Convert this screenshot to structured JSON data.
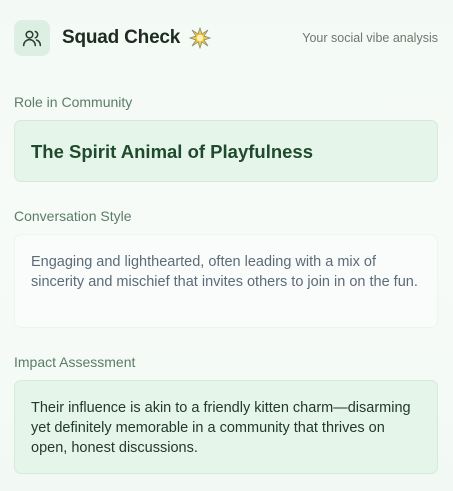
{
  "header": {
    "app_icon": "users-icon",
    "title": "Squad Check",
    "badge_icon": "sparkle-icon",
    "tagline": "Your social vibe analysis"
  },
  "sections": {
    "role": {
      "label": "Role in Community",
      "value": "The Spirit Animal of Playfulness"
    },
    "style": {
      "label": "Conversation Style",
      "value": "Engaging and lighthearted, often leading with a mix of sincerity and mischief that invites others to join in on the fun."
    },
    "impact": {
      "label": "Impact Assessment",
      "value": "Their influence is akin to a friendly kitten charm—disarming yet definitely memorable in a community that thrives on open, honest discussions."
    }
  },
  "colors": {
    "accent": "#1f4a2e",
    "card_green": "#e6f5ea",
    "label": "#5a7d66"
  }
}
